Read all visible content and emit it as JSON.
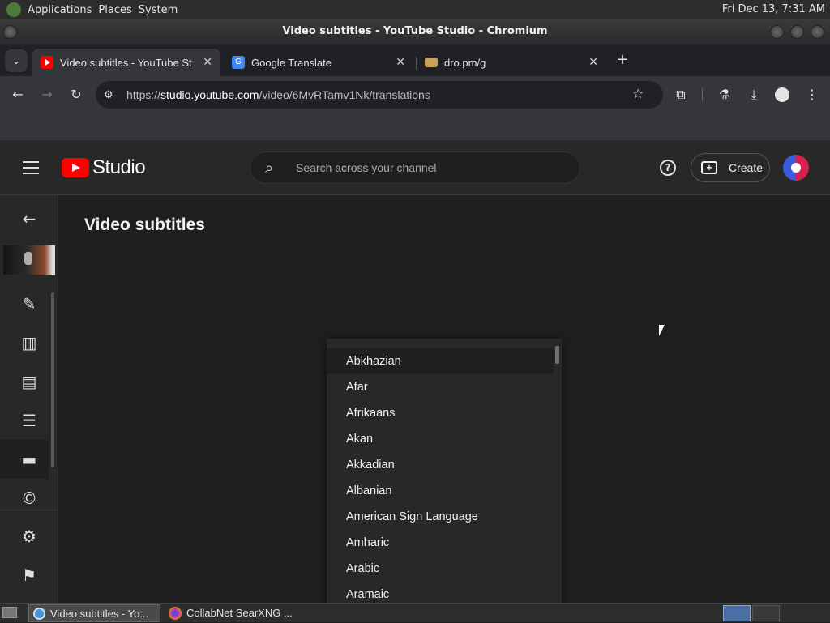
{
  "panel": {
    "menus": [
      "Applications",
      "Places",
      "System"
    ],
    "clock": "Fri Dec 13,  7:31 AM"
  },
  "window": {
    "title": "Video subtitles - YouTube Studio - Chromium"
  },
  "tabs": [
    {
      "label": "Video subtitles - YouTube St",
      "active": true
    },
    {
      "label": "Google Translate",
      "active": false
    },
    {
      "label": "dro.pm/g",
      "active": false
    }
  ],
  "omnibox": {
    "scheme": "https://",
    "host": "studio.youtube.com",
    "path": "/video/6MvRTamv1Nk/translations"
  },
  "studio": {
    "logo_text": "Studio",
    "search_placeholder": "Search across your channel",
    "create_label": "Create"
  },
  "main": {
    "title": "Video subtitles"
  },
  "languages": [
    "Abkhazian",
    "Afar",
    "Afrikaans",
    "Akan",
    "Akkadian",
    "Albanian",
    "American Sign Language",
    "Amharic",
    "Arabic",
    "Aramaic"
  ],
  "taskbar": [
    {
      "label": "Video subtitles - Yo...",
      "active": true
    },
    {
      "label": "CollabNet SearXNG ...",
      "active": false
    }
  ],
  "colors": {
    "youtube_red": "#ff0000",
    "accent_blue": "#3ea6ff"
  }
}
